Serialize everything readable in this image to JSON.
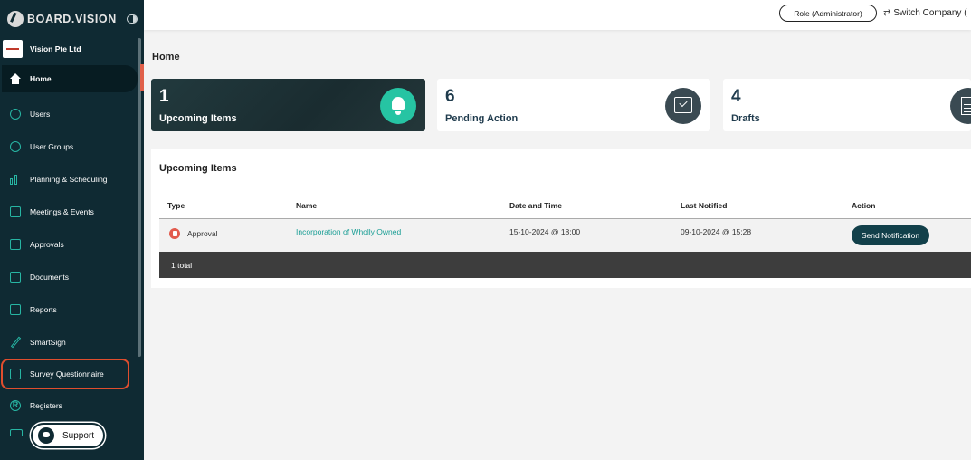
{
  "brand": {
    "name": "BOARD.VISION"
  },
  "company": {
    "name": "Vision Pte Ltd"
  },
  "sidebar": {
    "items": [
      {
        "label": "Home",
        "icon": "home-icon"
      },
      {
        "label": "Users",
        "icon": "user-icon"
      },
      {
        "label": "User Groups",
        "icon": "users-icon"
      },
      {
        "label": "Planning & Scheduling",
        "icon": "chart-icon"
      },
      {
        "label": "Meetings & Events",
        "icon": "calendar-icon"
      },
      {
        "label": "Approvals",
        "icon": "approval-icon"
      },
      {
        "label": "Documents",
        "icon": "documents-icon"
      },
      {
        "label": "Reports",
        "icon": "reports-icon"
      },
      {
        "label": "SmartSign",
        "icon": "pen-icon"
      },
      {
        "label": "Survey Questionnaire",
        "icon": "survey-icon"
      },
      {
        "label": "Registers",
        "icon": "registers-icon",
        "glyph": "R"
      }
    ],
    "support_label": "Support"
  },
  "topbar": {
    "role_label": "Role (Administrator)",
    "switch_label": "Switch Company (",
    "switch_glyph": "⇄"
  },
  "page": {
    "title": "Home"
  },
  "cards": [
    {
      "count": "1",
      "label": "Upcoming Items"
    },
    {
      "count": "6",
      "label": "Pending Action"
    },
    {
      "count": "4",
      "label": "Drafts"
    }
  ],
  "upcoming": {
    "title": "Upcoming Items",
    "columns": [
      "Type",
      "Name",
      "Date and Time",
      "Last Notified",
      "Action"
    ],
    "rows": [
      {
        "type": "Approval",
        "name": "Incorporation of Wholly Owned",
        "datetime": "15-10-2024 @ 18:00",
        "last_notified": "09-10-2024 @ 15:28",
        "action": "Send Notification"
      }
    ],
    "total": "1 total"
  },
  "colors": {
    "sidebar_bg": "#0f2a33",
    "accent": "#26c4a3",
    "highlight": "#e04e2e",
    "link": "#1a9e95"
  }
}
